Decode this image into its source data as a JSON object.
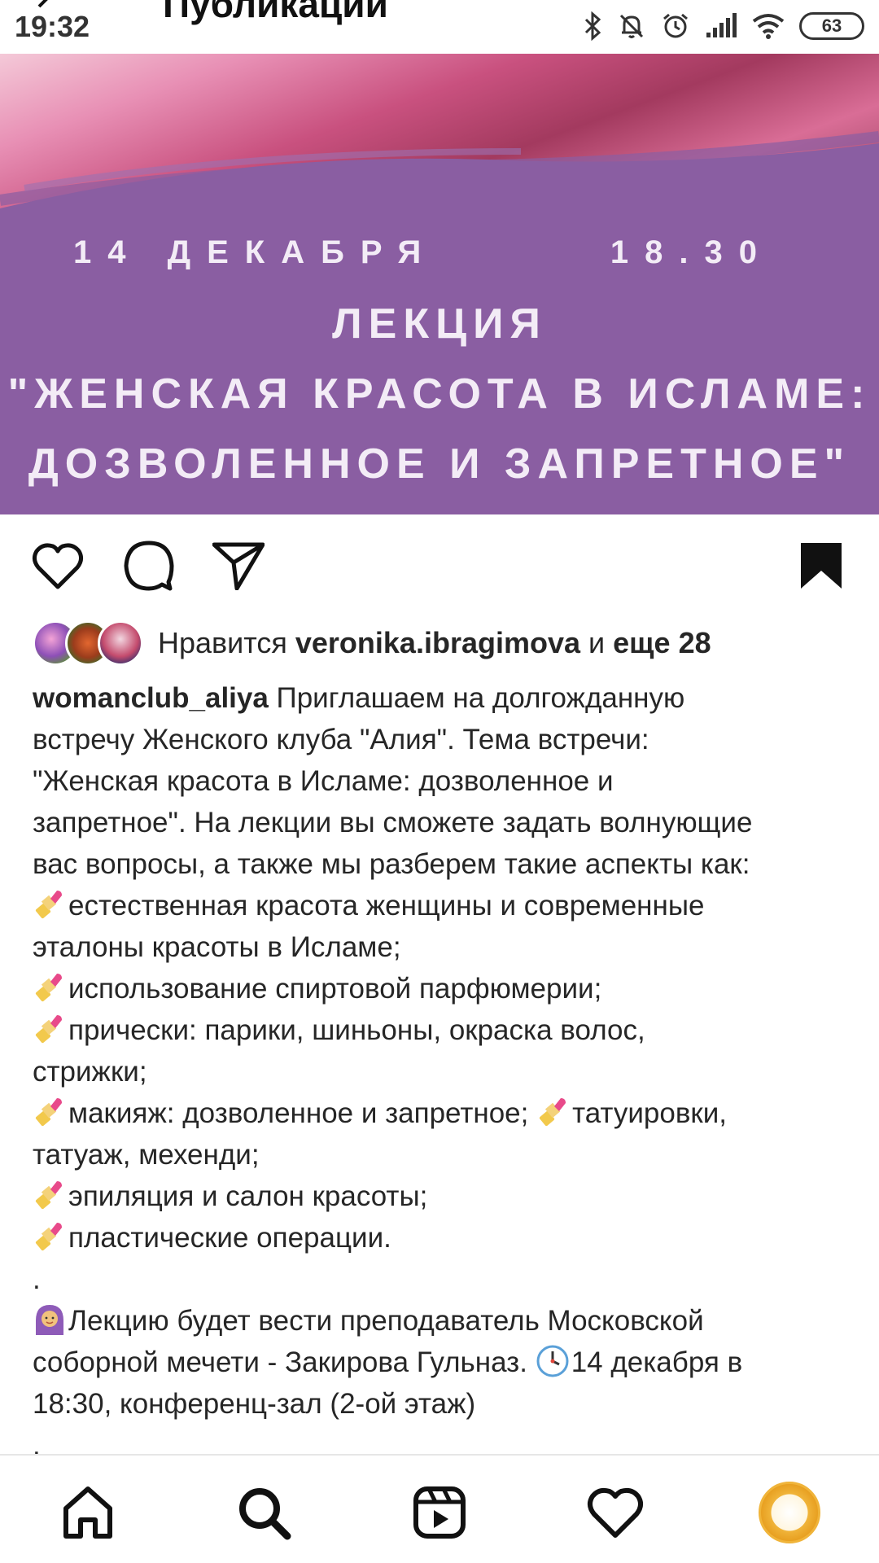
{
  "status_bar": {
    "time": "19:32",
    "screen_title": "Публикации",
    "battery": "63",
    "icons": [
      "bluetooth-icon",
      "mute-icon",
      "alarm-icon",
      "signal-icon",
      "wifi-icon",
      "battery-icon"
    ]
  },
  "post_image": {
    "date": "14 ДЕКАБРЯ",
    "time": "18.30",
    "lines": [
      "ЛЕКЦИЯ",
      "\"ЖЕНСКАЯ КРАСОТА В ИСЛАМЕ:",
      "ДОЗВОЛЕННОЕ И ЗАПРЕТНОЕ\""
    ]
  },
  "actions": [
    "like-icon",
    "comment-icon",
    "share-icon",
    "bookmark-icon"
  ],
  "likes": {
    "prefix": "Нравится",
    "user": "veronika.ibragimova",
    "conj": "и",
    "more": "еще 28"
  },
  "caption": {
    "username": "womanclub_aliya",
    "first_line_text": " Приглашаем на долгожданную",
    "lines": [
      {
        "emoji": false,
        "text": "встречу Женского клуба \"Алия\". Тема встречи:"
      },
      {
        "emoji": false,
        "text": "\"Женская красота в Исламе: дозволенное и"
      },
      {
        "emoji": false,
        "text": "запретное\". На лекции вы сможете задать волнующие"
      },
      {
        "emoji": false,
        "text": "вас вопросы, а также мы разберем такие аспекты как:"
      },
      {
        "emoji": "lipstick",
        "text": "естественная красота женщины и современные"
      },
      {
        "emoji": false,
        "text": "эталоны красоты в Исламе;"
      },
      {
        "emoji": "lipstick",
        "text": "использование спиртовой парфюмерии;"
      },
      {
        "emoji": "lipstick",
        "text": "прически: парики, шиньоны, окраска волос,"
      },
      {
        "emoji": false,
        "text": "стрижки;"
      },
      {
        "emoji": "lipstick",
        "text": "макияж: дозволенное и запретное; ",
        "emoji2": "lipstick",
        "text2": "татуировки,"
      },
      {
        "emoji": false,
        "text": "татуаж, мехенди;"
      },
      {
        "emoji": "lipstick",
        "text": "эпиляция и салон красоты;"
      },
      {
        "emoji": "lipstick",
        "text": "пластические операции."
      },
      {
        "emoji": false,
        "text": "."
      },
      {
        "emoji": "woman-headscarf",
        "text": "Лекцию будет вести преподаватель Московской"
      },
      {
        "emoji": false,
        "text": "соборной мечети - Закирова Гульназ. ",
        "emoji2": "clock",
        "text2": "14 декабря в"
      },
      {
        "emoji": false,
        "text": "18:30, конференц-зал (2-ой этаж)"
      },
      {
        "emoji": false,
        "text": "."
      }
    ]
  },
  "bottom_nav": [
    "home-icon",
    "search-icon",
    "reels-icon",
    "activity-icon",
    "profile-avatar"
  ],
  "colors": {
    "banner_purple": "#8a5ea2",
    "text": "#262626",
    "icon": "#111111"
  }
}
